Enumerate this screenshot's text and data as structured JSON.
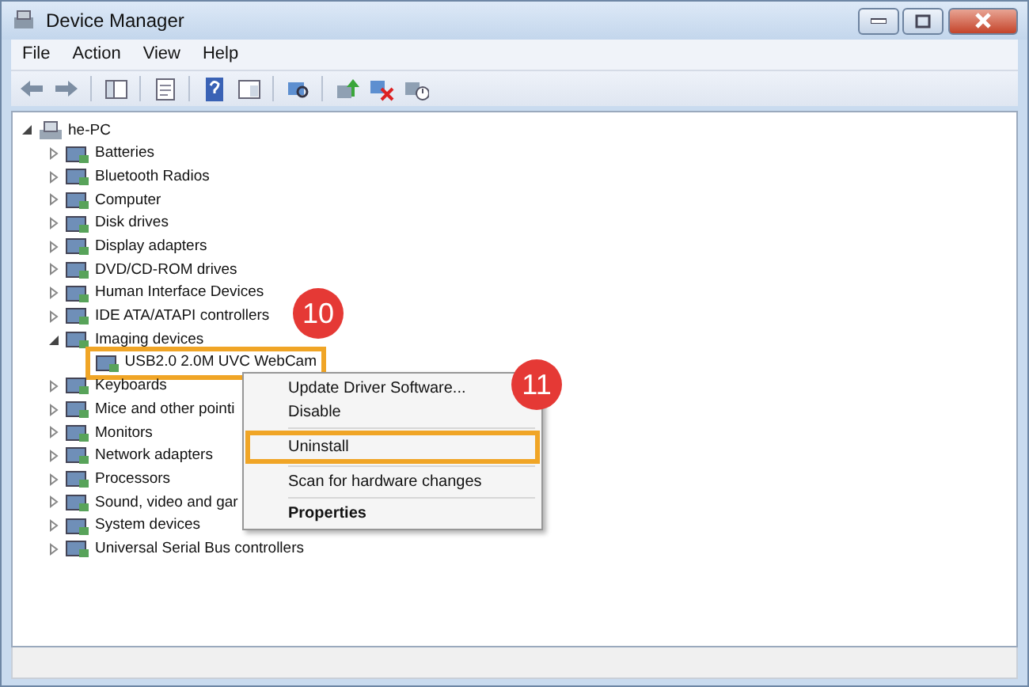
{
  "window": {
    "title": "Device Manager"
  },
  "menu_bar": [
    "File",
    "Action",
    "View",
    "Help"
  ],
  "tree": [
    {
      "label": "he-PC",
      "expanded": true,
      "children": [
        {
          "label": "Batteries",
          "expanded": false
        },
        {
          "label": "Bluetooth Radios",
          "expanded": false
        },
        {
          "label": "Computer",
          "expanded": false
        },
        {
          "label": "Disk drives",
          "expanded": false
        },
        {
          "label": "Display adapters",
          "expanded": false
        },
        {
          "label": "DVD/CD-ROM drives",
          "expanded": false
        },
        {
          "label": "Human Interface Devices",
          "expanded": false
        },
        {
          "label": "IDE ATA/ATAPI controllers",
          "expanded": false
        },
        {
          "label": "Imaging devices",
          "expanded": true,
          "children": [
            {
              "label": "USB2.0 2.0M UVC WebCam",
              "highlighted": true
            }
          ]
        },
        {
          "label": "Keyboards",
          "expanded": false
        },
        {
          "label": "Mice and other pointi",
          "expanded": false
        },
        {
          "label": "Monitors",
          "expanded": false
        },
        {
          "label": "Network adapters",
          "expanded": false
        },
        {
          "label": "Processors",
          "expanded": false
        },
        {
          "label": "Sound, video and gar",
          "expanded": false
        },
        {
          "label": "System devices",
          "expanded": false
        },
        {
          "label": "Universal Serial Bus controllers",
          "expanded": false
        }
      ]
    }
  ],
  "context_menu": [
    {
      "label": "Update Driver Software...",
      "bold": false,
      "highlighted": false
    },
    {
      "label": "Disable",
      "bold": false,
      "highlighted": false
    },
    {
      "label": "Uninstall",
      "bold": false,
      "highlighted": true
    },
    {
      "label": "Scan for hardware changes",
      "bold": false,
      "highlighted": false
    },
    {
      "label": "Properties",
      "bold": true,
      "highlighted": false
    }
  ],
  "step_badges": [
    "10",
    "11"
  ]
}
